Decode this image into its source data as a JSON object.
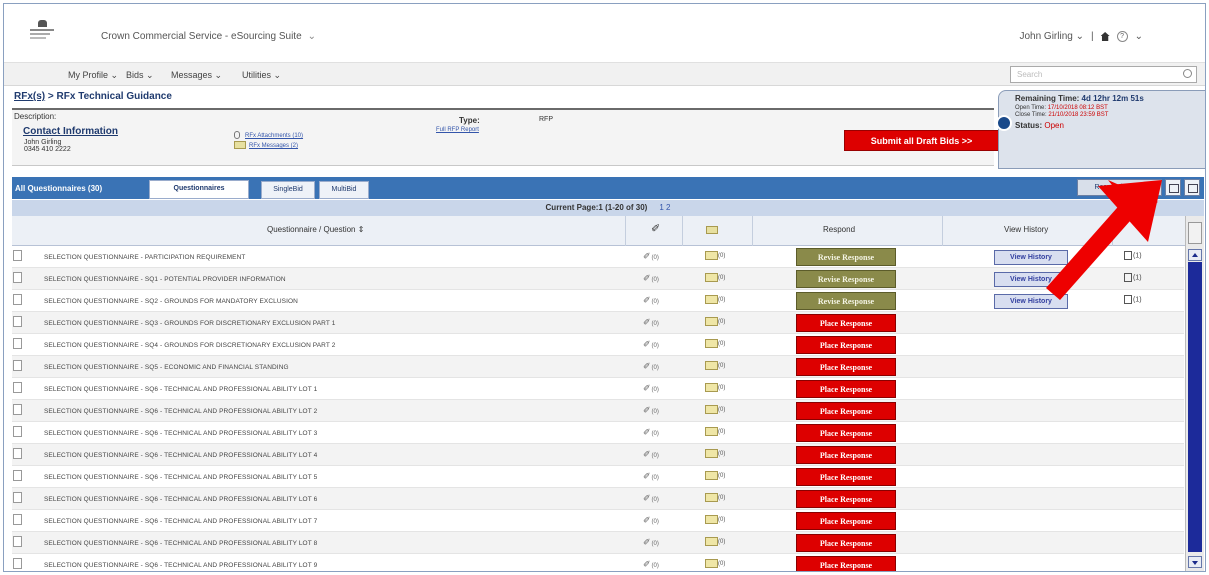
{
  "header": {
    "app_title": "Crown Commercial Service - eSourcing Suite",
    "user_name": "John Girling",
    "separator": "|"
  },
  "menu": {
    "items": [
      "My Profile",
      "Bids",
      "Messages",
      "Utilities"
    ],
    "search_placeholder": "Search"
  },
  "breadcrumb": {
    "link": "RFx(s)",
    "sep": " > ",
    "current": "RFx Technical Guidance"
  },
  "info": {
    "description_label": "Description:",
    "contact_label": "Contact Information",
    "contact_name": "John Girling",
    "contact_phone": "0345 410 2222",
    "attachments_link": "RFx Attachments (10)",
    "messages_link": "RFx Messages (2)",
    "type_label": "Type:",
    "type_value": "RFP",
    "full_rfp_link": "Full RFP Report",
    "submit_label": "Submit all Draft Bids >>"
  },
  "timing": {
    "remaining_label": "Remaining Time:",
    "remaining_value": "4d 12hr 12m 51s",
    "open_time_label": "Open Time:",
    "open_time_value": "17/10/2018 08:12 BST",
    "close_time_label": "Close Time:",
    "close_time_value": "21/10/2018 23:59 BST",
    "status_label": "Status:",
    "status_value": "Open"
  },
  "tabs": {
    "all_label": "All Questionnaires (30)",
    "items": [
      "Questionnaires",
      "SingleBid",
      "MultiBid"
    ],
    "respond_offline": "Respond Offline"
  },
  "pager": {
    "text": "Current Page:1 (1-20 of 30)",
    "pages": "1 2"
  },
  "columns": {
    "question": "Questionnaire / Question",
    "respond": "Respond",
    "history": "View History"
  },
  "rows": [
    {
      "q": "SELECTION QUESTIONNAIRE - PARTICIPATION REQUIREMENT",
      "pc": "(0)",
      "env": "(0)",
      "action": "Revise Response",
      "history": "View History",
      "doc": "(1)"
    },
    {
      "q": "SELECTION QUESTIONNAIRE - SQ1 - POTENTIAL PROVIDER INFORMATION",
      "pc": "(0)",
      "env": "(0)",
      "action": "Revise Response",
      "history": "View History",
      "doc": "(1)"
    },
    {
      "q": "SELECTION QUESTIONNAIRE - SQ2 - GROUNDS FOR MANDATORY EXCLUSION",
      "pc": "(0)",
      "env": "(0)",
      "action": "Revise Response",
      "history": "View History",
      "doc": "(1)"
    },
    {
      "q": "SELECTION QUESTIONNAIRE - SQ3 - GROUNDS FOR DISCRETIONARY EXCLUSION PART 1",
      "pc": "(0)",
      "env": "(0)",
      "action": "Place Response",
      "history": "",
      "doc": ""
    },
    {
      "q": "SELECTION QUESTIONNAIRE - SQ4 - GROUNDS FOR DISCRETIONARY EXCLUSION PART 2",
      "pc": "(0)",
      "env": "(0)",
      "action": "Place Response",
      "history": "",
      "doc": ""
    },
    {
      "q": "SELECTION QUESTIONNAIRE - SQ5 - ECONOMIC AND FINANCIAL STANDING",
      "pc": "(0)",
      "env": "(0)",
      "action": "Place Response",
      "history": "",
      "doc": ""
    },
    {
      "q": "SELECTION QUESTIONNAIRE - SQ6 - TECHNICAL AND PROFESSIONAL ABILITY LOT 1",
      "pc": "(0)",
      "env": "(0)",
      "action": "Place Response",
      "history": "",
      "doc": ""
    },
    {
      "q": "SELECTION QUESTIONNAIRE - SQ6 - TECHNICAL AND PROFESSIONAL ABILITY LOT 2",
      "pc": "(0)",
      "env": "(0)",
      "action": "Place Response",
      "history": "",
      "doc": ""
    },
    {
      "q": "SELECTION QUESTIONNAIRE - SQ6 - TECHNICAL AND PROFESSIONAL ABILITY LOT 3",
      "pc": "(0)",
      "env": "(0)",
      "action": "Place Response",
      "history": "",
      "doc": ""
    },
    {
      "q": "SELECTION QUESTIONNAIRE - SQ6 - TECHNICAL AND PROFESSIONAL ABILITY LOT 4",
      "pc": "(0)",
      "env": "(0)",
      "action": "Place Response",
      "history": "",
      "doc": ""
    },
    {
      "q": "SELECTION QUESTIONNAIRE - SQ6 - TECHNICAL AND PROFESSIONAL ABILITY LOT 5",
      "pc": "(0)",
      "env": "(0)",
      "action": "Place Response",
      "history": "",
      "doc": ""
    },
    {
      "q": "SELECTION QUESTIONNAIRE - SQ6 - TECHNICAL AND PROFESSIONAL ABILITY LOT 6",
      "pc": "(0)",
      "env": "(0)",
      "action": "Place Response",
      "history": "",
      "doc": ""
    },
    {
      "q": "SELECTION QUESTIONNAIRE - SQ6 - TECHNICAL AND PROFESSIONAL ABILITY LOT 7",
      "pc": "(0)",
      "env": "(0)",
      "action": "Place Response",
      "history": "",
      "doc": ""
    },
    {
      "q": "SELECTION QUESTIONNAIRE - SQ6 - TECHNICAL AND PROFESSIONAL ABILITY LOT 8",
      "pc": "(0)",
      "env": "(0)",
      "action": "Place Response",
      "history": "",
      "doc": ""
    },
    {
      "q": "SELECTION QUESTIONNAIRE - SQ6 - TECHNICAL AND PROFESSIONAL ABILITY LOT 9",
      "pc": "(0)",
      "env": "(0)",
      "action": "Place Response",
      "history": "",
      "doc": ""
    }
  ],
  "colors": {
    "tab_bar": "#3a73b5",
    "revise_button": "#8a8a4a",
    "place_button": "#dd0000",
    "annotation_arrow": "#ee0000"
  },
  "icons": {
    "row_expander": "expand-box-icon",
    "attachment": "paperclip-icon",
    "message": "envelope-icon",
    "document": "document-icon",
    "home": "home-icon",
    "help": "help-icon",
    "clock": "clock-icon"
  }
}
